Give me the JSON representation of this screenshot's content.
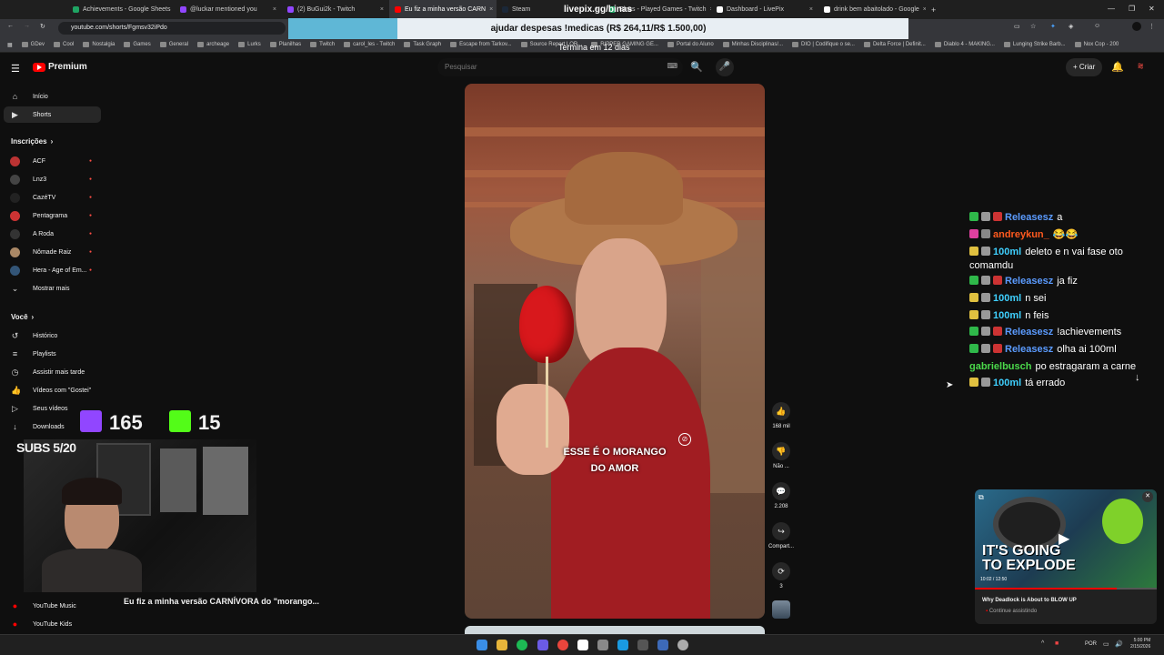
{
  "browser": {
    "tabs": [
      {
        "title": "Achievements - Google Sheets",
        "color": "#1fa463"
      },
      {
        "title": "@luckar mentioned you",
        "color": "#9146ff"
      },
      {
        "title": "(2) BuGui2k - Twitch",
        "color": "#9146ff"
      },
      {
        "title": "Eu fiz a minha versão CARN",
        "color": "#ff0000",
        "active": true
      },
      {
        "title": "Steam",
        "color": "#1b2838"
      },
      {
        "title": "Binas - Played Games - Twitch",
        "color": "#1fa463"
      },
      {
        "title": "Dashboard - LivePix",
        "color": "#ffffff"
      },
      {
        "title": "drink bem abaitolado - Google",
        "color": "#ffffff"
      }
    ],
    "url": "youtube.com/shorts/Fgmsv32iPdo",
    "bookmarks": [
      "GDev",
      "Cool",
      "Nostalgia",
      "Games",
      "General",
      "archeage",
      "Lurks",
      "Planilhas",
      "Twitch",
      "carol_les - Twitch",
      "Task Graph",
      "Escape from Tarkov...",
      "Source Report LOR...",
      "RIPPER GAMING GE...",
      "Portal do Aluno",
      "Minhas Disciplinas/...",
      "DIO | Codifique o se...",
      "Delta Force | Definit...",
      "Diablo 4 - MAKING...",
      "Lunging Strike Barb...",
      "Nox Cop - 200"
    ]
  },
  "overlay": {
    "livepix": "livepix.gg/binas",
    "donation": "ajudar despesas !medicas (R$ 264,11/R$ 1.500,00)",
    "donation_progress": 0.176,
    "termina": "Termina em 12 dias",
    "twitch_count": "165",
    "kick_count": "15",
    "subs": "SUBS 5/20"
  },
  "youtube": {
    "logo": "Premium",
    "search_placeholder": "Pesquisar",
    "create": "Criar",
    "nav": [
      {
        "label": "Início",
        "icon": "home-icon",
        "glyph": "⌂"
      },
      {
        "label": "Shorts",
        "icon": "shorts-icon",
        "glyph": "▶"
      }
    ],
    "subs_heading": "Inscrições",
    "subscriptions": [
      {
        "label": "ACF",
        "color": "#b33"
      },
      {
        "label": "Lnz3",
        "color": "#444"
      },
      {
        "label": "CazéTV",
        "color": "#222"
      },
      {
        "label": "Pentagrama",
        "color": "#c33"
      },
      {
        "label": "A Roda",
        "color": "#333"
      },
      {
        "label": "Nômade Raiz",
        "color": "#a86"
      },
      {
        "label": "Hera - Age of Em...",
        "color": "#357"
      }
    ],
    "show_more": "Mostrar mais",
    "you_heading": "Você",
    "you_items": [
      {
        "label": "Histórico",
        "glyph": "↺"
      },
      {
        "label": "Playlists",
        "glyph": "≡"
      },
      {
        "label": "Assistir mais tarde",
        "glyph": "◷"
      },
      {
        "label": "Vídeos com \"Gostei\"",
        "glyph": "👍"
      },
      {
        "label": "Seus vídeos",
        "glyph": "▷"
      },
      {
        "label": "Downloads",
        "glyph": "↓"
      }
    ],
    "bottom_items": [
      "YouTube Music",
      "YouTube Kids"
    ],
    "short_title": "Eu fiz a minha versão CARNÍVORA do \"morango...",
    "caption_line1": "ESSE É O MORANGO",
    "caption_line2": "DO AMOR",
    "actions": [
      {
        "glyph": "👍",
        "label": "168 mil"
      },
      {
        "glyph": "👎",
        "label": "Não ..."
      },
      {
        "glyph": "💬",
        "label": "2.208"
      },
      {
        "glyph": "↪",
        "label": "Compart..."
      },
      {
        "glyph": "⟳",
        "label": "3"
      }
    ],
    "mini_player": {
      "title": "Why Deadlock is About to BLOW UP",
      "subtitle": "Continue assistindo",
      "thumb_text1": "IT'S GOING",
      "thumb_text2": "TO EXPLODE",
      "time": "10:02 / 12:50"
    }
  },
  "chat": [
    {
      "user": "Releasesz",
      "color": "#5b9bff",
      "msg": "a"
    },
    {
      "user": "andreykun_",
      "color": "#ff5a1f",
      "msg": "😂😂"
    },
    {
      "user": "100ml",
      "color": "#3fd0ff",
      "msg": "deleto e n vai fase oto comamdu"
    },
    {
      "user": "Releasesz",
      "color": "#5b9bff",
      "msg": "ja fiz"
    },
    {
      "user": "100ml",
      "color": "#3fd0ff",
      "msg": "n sei"
    },
    {
      "user": "100ml",
      "color": "#3fd0ff",
      "msg": "n feis"
    },
    {
      "user": "Releasesz",
      "color": "#5b9bff",
      "msg": "!achievements"
    },
    {
      "user": "Releasesz",
      "color": "#5b9bff",
      "msg": "olha ai 100ml"
    },
    {
      "user": "gabrielbusch",
      "color": "#4bd94b",
      "msg": "po estragaram a carne"
    },
    {
      "user": "100ml",
      "color": "#3fd0ff",
      "msg": "tá errado"
    }
  ],
  "taskbar": {
    "lang": "POR",
    "time": "5:00 PM",
    "date": "2/15/2026"
  }
}
